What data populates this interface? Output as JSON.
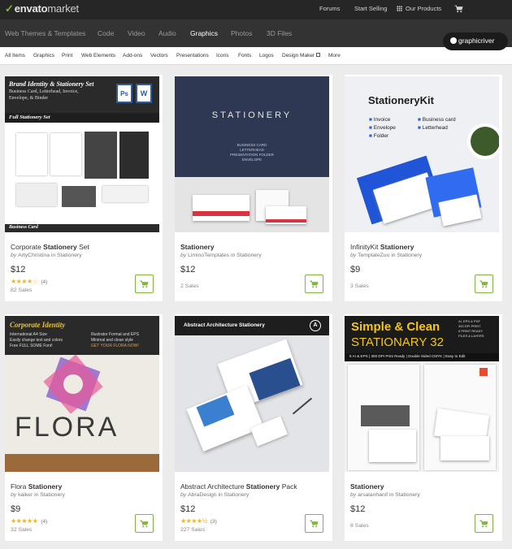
{
  "brand": {
    "leaf": "✓",
    "envato": "envato",
    "market": "market"
  },
  "topnav": {
    "forums": "Forums",
    "start_selling": "Start Selling",
    "our_products": "Our Products"
  },
  "categories": [
    "Web Themes & Templates",
    "Code",
    "Video",
    "Audio",
    "Graphics",
    "Photos",
    "3D Files"
  ],
  "graphicriver_badge": "graphicriver",
  "subcategories": [
    "All Items",
    "Graphics",
    "Print",
    "Web Elements",
    "Add-ons",
    "Vectors",
    "Presentations",
    "Icons",
    "Fonts",
    "Logos",
    "Design Maker",
    "More"
  ],
  "cards": [
    {
      "title_pre": "Corporate ",
      "title_bold": "Stationery",
      "title_post": " Set",
      "by": "by ",
      "author": "ArtyChristina",
      "in": " in Stationery",
      "price": "$12",
      "stars": "★★★★☆",
      "rating_count": "(4)",
      "sales": "82 Sales",
      "thumb": {
        "heading": "Brand Identity & Stationery Set",
        "sub1": "Business Card, Letterhead, Invoice,",
        "sub2": "Envelope, & Binder",
        "band": "Full Stationery Set",
        "footer": "Business Card",
        "ps": "Ps",
        "w": "W"
      }
    },
    {
      "title_pre": "",
      "title_bold": "Stationery",
      "title_post": "",
      "by": "by ",
      "author": "LiminoTemplates",
      "in": " in Stationery",
      "price": "$12",
      "stars": "",
      "rating_count": "",
      "sales": "2 Sales",
      "thumb": {
        "heading": "STATIONERY",
        "line1": "BUSINESS CARD",
        "line2": "LETTERHEAD",
        "line3": "PRESENTATION FOLDER",
        "line4": "ENVELOPE"
      }
    },
    {
      "title_pre": "InfinityKit ",
      "title_bold": "Stationery",
      "title_post": "",
      "by": "by ",
      "author": "TemplateZuu",
      "in": " in Stationery",
      "price": "$9",
      "stars": "",
      "rating_count": "",
      "sales": "3 Sales",
      "thumb": {
        "heading": "StationeryKit",
        "items": [
          "Invoice",
          "Business card",
          "Envelope",
          "Letterhead",
          "Folder"
        ]
      }
    },
    {
      "title_pre": "Flora ",
      "title_bold": "Stationery",
      "title_post": "",
      "by": "by ",
      "author": "kaiker",
      "in": " in Stationery",
      "price": "$9",
      "stars": "★★★★★",
      "rating_count": "(4)",
      "sales": "32 Sales",
      "thumb": {
        "heading": "Corporate Identity",
        "l1": "International A4 Size",
        "l2": "Easily change text and colors",
        "l3": "Free FULL SOME Font!",
        "r1": "Illustrator Format and EPS",
        "r2": "Minimal and clean style",
        "r3": "GET YOUR FLORA NOW!",
        "brandname": "FLORA"
      }
    },
    {
      "title_pre": "Abstract Architecture ",
      "title_bold": "Stationery",
      "title_post": " Pack",
      "by": "by ",
      "author": "AbraDesign",
      "in": " in Stationery",
      "price": "$12",
      "stars": "★★★★½",
      "rating_count": "(3)",
      "sales": "227 Sales",
      "thumb": {
        "heading": "Abstract Architecture Stationery",
        "mark": "A"
      }
    },
    {
      "title_pre": "",
      "title_bold": "Stationery",
      "title_post": "",
      "by": "by ",
      "author": "arsalanhanif",
      "in": " in Stationery",
      "price": "$12",
      "stars": "",
      "rating_count": "",
      "sales": "8 Sales",
      "thumb": {
        "h1": "Simple & Clean",
        "h2": "STATIONARY 32",
        "notes": [
          "AI, EPS & PDF",
          "300 DPI PRINT",
          "6 PRINT READY",
          "FILES & LAYERS"
        ],
        "strip": "5 AI & EPS | 300 DPI Print Ready | Double Sided CMYK | Easy to Edit"
      }
    }
  ],
  "colors": {
    "accent_green": "#82b541",
    "star": "#f5b21b",
    "topbar": "#262626",
    "catbar": "#333333"
  }
}
